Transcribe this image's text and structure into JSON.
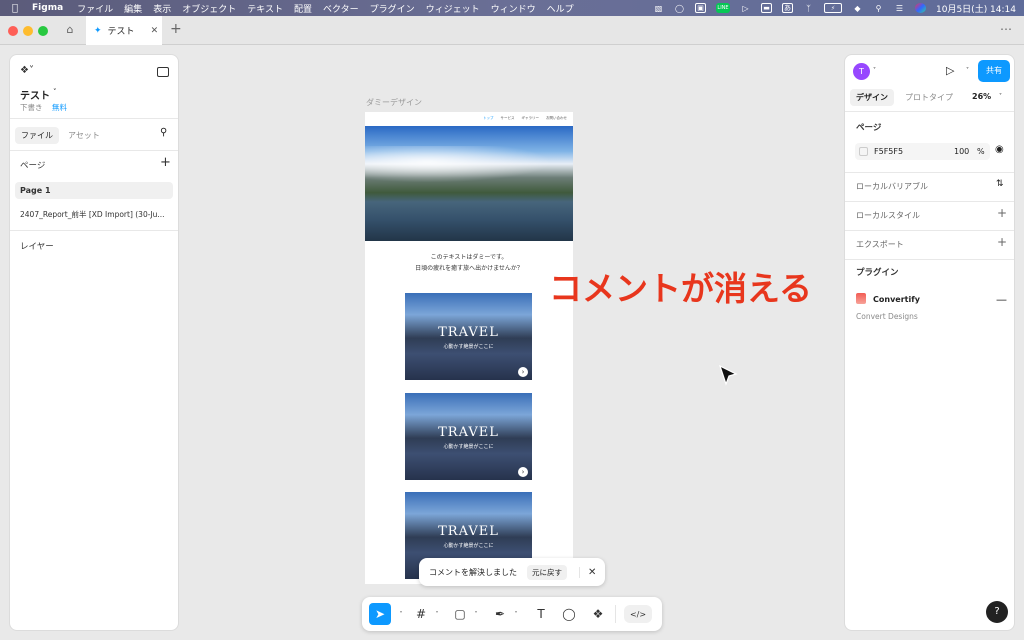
{
  "menubar": {
    "app": "Figma",
    "items": [
      "ファイル",
      "編集",
      "表示",
      "オブジェクト",
      "テキスト",
      "配置",
      "ベクター",
      "プラグイン",
      "ウィジェット",
      "ウィンドウ",
      "ヘルプ"
    ],
    "ime": "あ",
    "datetime": "10月5日(土) 14:14"
  },
  "tabbar": {
    "tab_label": "テスト"
  },
  "left": {
    "file_name": "テスト",
    "draft": "下書き",
    "plan": "無料",
    "tab_file": "ファイル",
    "tab_assets": "アセット",
    "pages_header": "ページ",
    "pages": [
      "Page 1",
      "2407_Report_前半 [XD Import] (30-Ju..."
    ],
    "layers_header": "レイヤー"
  },
  "canvas": {
    "frame_label": "ダミーデザイン",
    "nav": [
      "トップ",
      "サービス",
      "ギャラリー",
      "お問い合わせ"
    ],
    "intro_line1": "このテキストはダミーです。",
    "intro_line2": "日頃の疲れを癒す旅へ出かけませんか？",
    "cards": [
      {
        "title": "TRAVEL",
        "sub": "心動かす絶景がここに"
      },
      {
        "title": "TRAVEL",
        "sub": "心動かす絶景がここに"
      },
      {
        "title": "TRAVEL",
        "sub": "心動かす絶景がここに"
      }
    ],
    "annotation": "コメントが消える"
  },
  "toast": {
    "message": "コメントを解決しました",
    "undo": "元に戻す"
  },
  "right": {
    "avatar": "T",
    "share": "共有",
    "tab_design": "デザイン",
    "tab_prototype": "プロトタイプ",
    "zoom": "26%",
    "page_header": "ページ",
    "bg_hex": "F5F5F5",
    "bg_opacity": "100",
    "pct": "%",
    "local_variables": "ローカルバリアブル",
    "local_styles": "ローカルスタイル",
    "export": "エクスポート",
    "plugin_header": "プラグイン",
    "plugin_name": "Convertify",
    "plugin_desc": "Convert Designs",
    "help": "?"
  },
  "colors": {
    "accent": "#0d99ff",
    "avatar": "#9747ff",
    "annotation": "#e8361d"
  }
}
